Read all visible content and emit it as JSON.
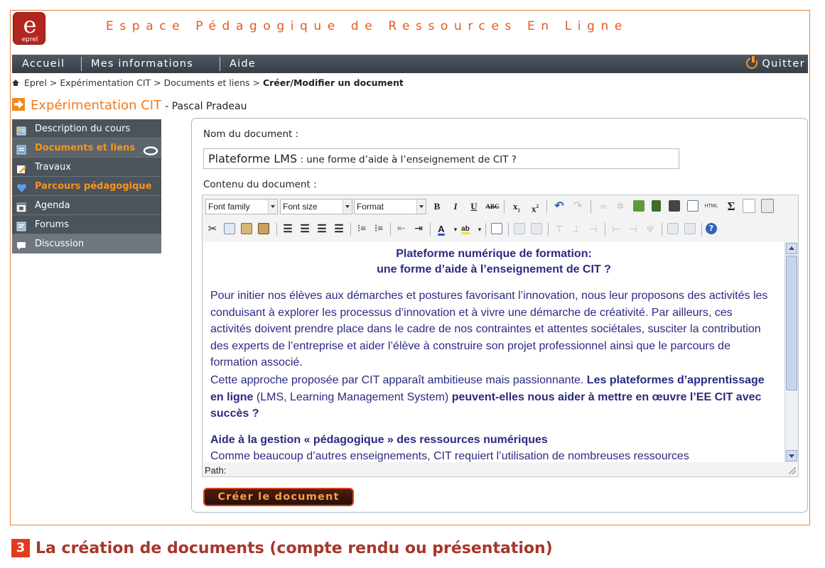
{
  "app": {
    "logo_big": "e",
    "logo_small": "eprel",
    "title": "Espace Pédagogique de Ressources En Ligne"
  },
  "nav": {
    "items": [
      "Accueil",
      "Mes informations",
      "Aide"
    ],
    "quit": "Quitter"
  },
  "breadcrumb": {
    "parts": [
      "Eprel",
      "Expérimentation CIT",
      "Documents et liens"
    ],
    "separator": ">",
    "current": "Créer/Modifier un document"
  },
  "course": {
    "name": "Expérimentation CIT",
    "author": "- Pascal Pradeau"
  },
  "sidebar": {
    "items": [
      {
        "label": "Description du cours",
        "icon": "course-description-icon",
        "active": false
      },
      {
        "label": "Documents et liens",
        "icon": "documents-icon",
        "active": true
      },
      {
        "label": "Travaux",
        "icon": "pencil-icon",
        "active": false
      },
      {
        "label": "Parcours pédagogique",
        "icon": "heart-icon",
        "active": true
      },
      {
        "label": "Agenda",
        "icon": "calendar-icon",
        "active": false
      },
      {
        "label": "Forums",
        "icon": "forum-icon",
        "active": false
      },
      {
        "label": "Discussion",
        "icon": "chat-icon",
        "active": false
      }
    ]
  },
  "form": {
    "name_label": "Nom du document :",
    "name_value_prefix": "Plateforme LMS",
    "name_value_rest": " : une forme d’aide à l’enseignement de CIT ?",
    "content_label": "Contenu du document :",
    "submit": "Créer le document"
  },
  "editor": {
    "font_family": "Font family",
    "font_size": "Font size",
    "format": "Format",
    "path_label": "Path:",
    "doc_title_line1": "Plateforme numérique de formation:",
    "doc_title_line2": "une forme d’aide à l’enseignement de CIT ?",
    "paragraph1": " Pour initier nos élèves aux démarches et postures favorisant l’innovation, nous leur proposons des activités les conduisant à explorer les processus d’innovation et à vivre une démarche de créativité. Par ailleurs, ces activités doivent prendre place dans le cadre de nos contraintes et attentes sociétales, susciter la contribution des experts de l’entreprise et aider l’élève à construire son projet professionnel ainsi que le parcours de formation associé.",
    "paragraph2_a": "Cette approche proposée par CIT apparaît ambitieuse mais passionnante. ",
    "paragraph2_b": "Les plateformes d’apprentissage en ligne",
    "paragraph2_c": " (LMS, Learning Management System) ",
    "paragraph2_d": "peuvent-elles nous aider à mettre en œuvre l’EE CIT avec succès ?",
    "heading2": "Aide à la gestion « pédagogique » des ressources numériques",
    "paragraph3": "Comme beaucoup d’autres enseignements, CIT requiert l’utilisation de nombreuses ressources"
  },
  "caption": {
    "number": "3",
    "text": "La création de documents (compte rendu ou présentation)"
  },
  "colors": {
    "accent": "#ef7a1e",
    "nav_bg": "#3f4850",
    "doc_text": "#2b2a83",
    "caption": "#a8362a"
  }
}
